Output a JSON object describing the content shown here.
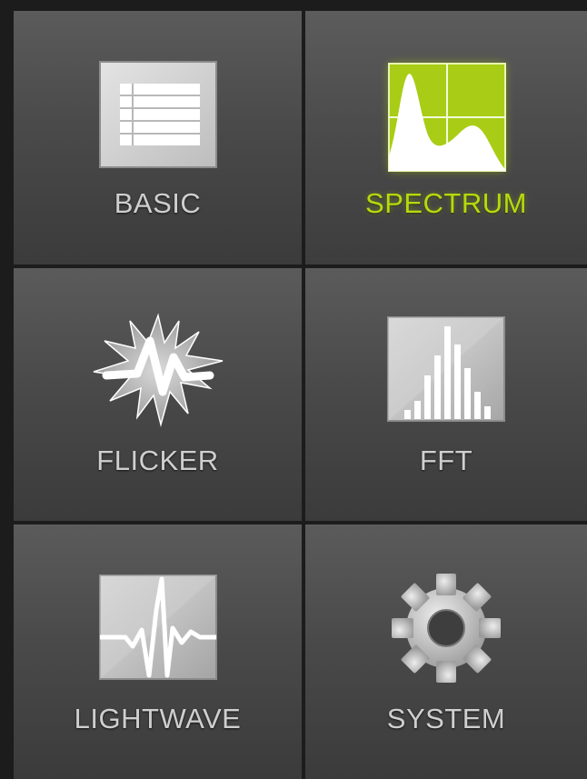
{
  "menu": {
    "accent_color": "#b7d80f",
    "selected": "SPECTRUM",
    "items": [
      {
        "label": "BASIC",
        "icon": "list-icon"
      },
      {
        "label": "SPECTRUM",
        "icon": "spectrum-icon"
      },
      {
        "label": "FLICKER",
        "icon": "flicker-burst-icon"
      },
      {
        "label": "FFT",
        "icon": "fft-bars-icon"
      },
      {
        "label": "LIGHTWAVE",
        "icon": "lightwave-icon"
      },
      {
        "label": "SYSTEM",
        "icon": "gear-icon"
      }
    ]
  }
}
